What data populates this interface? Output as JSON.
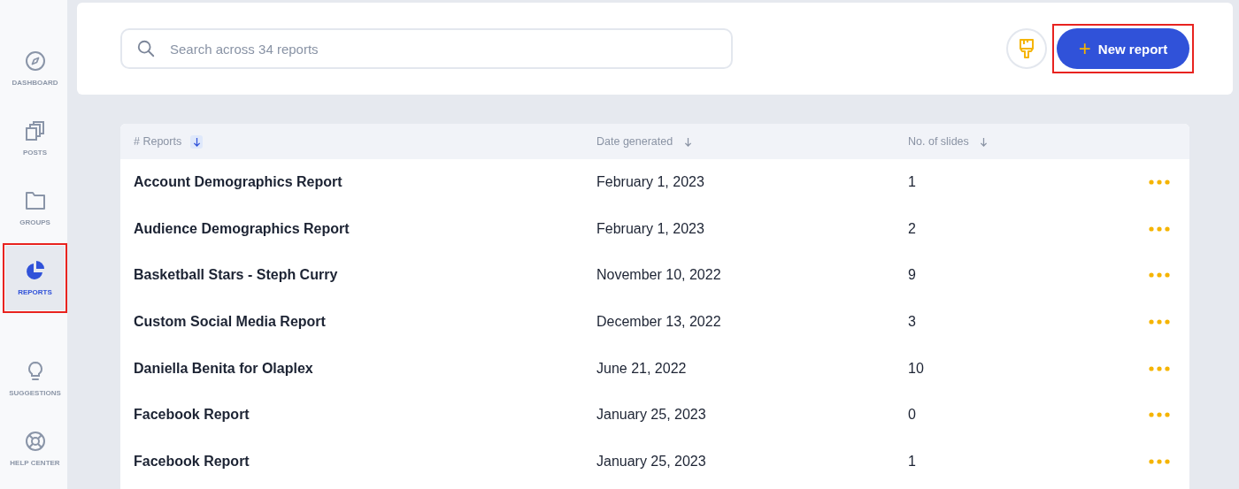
{
  "sidebar": {
    "items": [
      {
        "label": "DASHBOARD",
        "selected": false,
        "highlighted": false
      },
      {
        "label": "POSTS",
        "selected": false,
        "highlighted": false
      },
      {
        "label": "GROUPS",
        "selected": false,
        "highlighted": false
      },
      {
        "label": "REPORTS",
        "selected": true,
        "highlighted": true
      }
    ],
    "bottom_items": [
      {
        "label": "SUGGESTIONS",
        "selected": false,
        "highlighted": false
      },
      {
        "label": "HELP CENTER",
        "selected": false,
        "highlighted": false
      }
    ]
  },
  "search": {
    "placeholder": "Search across 34 reports"
  },
  "new_report_button": {
    "label": "New report",
    "icon": "+",
    "highlighted": true
  },
  "table": {
    "columns": [
      {
        "label": "# Reports",
        "sort_active": true
      },
      {
        "label": "Date generated",
        "sort_active": false
      },
      {
        "label": "No. of slides",
        "sort_active": false
      }
    ],
    "rows": [
      {
        "name": "Account Demographics Report",
        "date": "February 1, 2023",
        "slides": "1"
      },
      {
        "name": "Audience Demographics Report",
        "date": "February 1, 2023",
        "slides": "2"
      },
      {
        "name": "Basketball Stars - Steph Curry",
        "date": "November 10, 2022",
        "slides": "9"
      },
      {
        "name": "Custom Social Media Report",
        "date": "December 13, 2022",
        "slides": "3"
      },
      {
        "name": "Daniella Benita for Olaplex",
        "date": "June 21, 2022",
        "slides": "10"
      },
      {
        "name": "Facebook Report",
        "date": "January 25, 2023",
        "slides": "0"
      },
      {
        "name": "Facebook Report",
        "date": "January 25, 2023",
        "slides": "1"
      }
    ]
  }
}
